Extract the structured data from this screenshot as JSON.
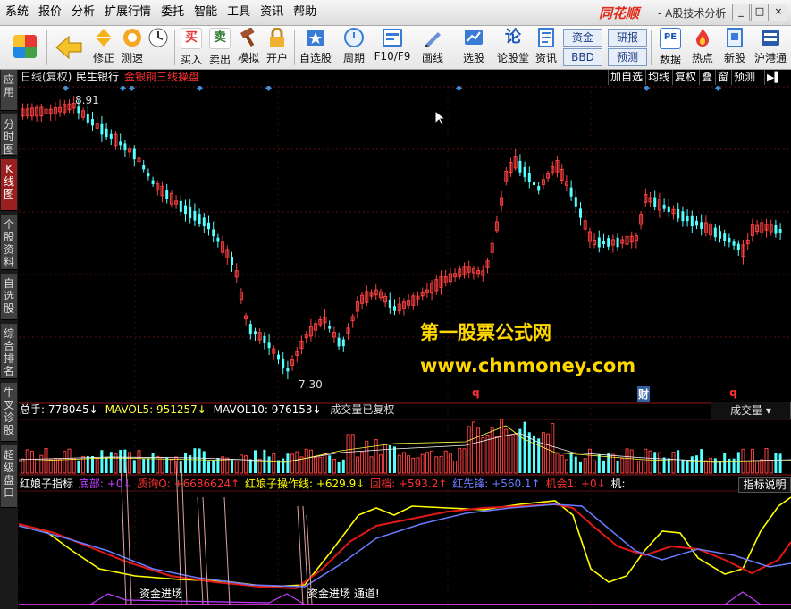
{
  "menubar": {
    "items": [
      "系统",
      "报价",
      "分析",
      "扩展行情",
      "委托",
      "智能",
      "工具",
      "资讯",
      "帮助"
    ],
    "logo": "同花顺",
    "app_subtitle": "- A股技术分析",
    "win_controls": [
      "_",
      "□",
      "×"
    ]
  },
  "toolbar": {
    "buttons": [
      {
        "label": "",
        "icon": "layout-icon"
      },
      {
        "label": "",
        "icon": "back-arrow-icon"
      },
      {
        "label": "修正",
        "icon": "up-down-icon"
      },
      {
        "label": "测速",
        "icon": "speed-icon"
      },
      {
        "label": "",
        "icon": "clock-icon"
      },
      {
        "label": "买入",
        "icon": "buy-icon",
        "glyph": "买"
      },
      {
        "label": "卖出",
        "icon": "sell-icon",
        "glyph": "卖"
      },
      {
        "label": "模拟",
        "icon": "hammer-icon"
      },
      {
        "label": "开户",
        "icon": "lock-icon"
      },
      {
        "label": "自选股",
        "icon": "star-icon"
      },
      {
        "label": "周期",
        "icon": "period-icon"
      },
      {
        "label": "F10/F9",
        "icon": "f10-icon"
      },
      {
        "label": "画线",
        "icon": "pen-icon"
      },
      {
        "label": "选股",
        "icon": "select-icon"
      },
      {
        "label": "论股堂",
        "icon": "forum-icon",
        "glyph": "论"
      },
      {
        "label": "资讯",
        "icon": "news-icon"
      },
      {
        "label": "数据",
        "icon": "pe-icon",
        "glyph": "PE"
      },
      {
        "label": "热点",
        "icon": "hot-icon"
      },
      {
        "label": "新股",
        "icon": "ipo-icon"
      },
      {
        "label": "沪港通",
        "icon": "hk-icon"
      }
    ],
    "pills": [
      "资金",
      "研报",
      "BBD",
      "预测"
    ]
  },
  "sidebar": {
    "tabs": [
      {
        "label": "应用",
        "active": false
      },
      {
        "label": "分时图",
        "active": false
      },
      {
        "label": "K线图",
        "active": true
      },
      {
        "label": "个股资料",
        "active": false
      },
      {
        "label": "自选股",
        "active": false
      },
      {
        "label": "综合排名",
        "active": false
      },
      {
        "label": "牛叉诊股",
        "active": false
      },
      {
        "label": "超级盘口",
        "active": false
      }
    ]
  },
  "kline": {
    "period": "日线(复权)",
    "stock": "民生银行",
    "formula": "金银铜三线操盘",
    "buttons": [
      "加自选",
      "均线",
      "复权",
      "叠",
      "窗",
      "预测"
    ],
    "high_label": "8.91",
    "low_label": "7.30",
    "markers": [
      "q",
      "财",
      "q"
    ]
  },
  "volume": {
    "total_label": "总手: 778045↓",
    "mavol5_label": "MAVOL5: 951257↓",
    "mavol10_label": "MAVOL10: 976153↓",
    "status": "成交量已复权",
    "dropdown": "成交量"
  },
  "indicator": {
    "name": "红娘子指标",
    "parts": [
      {
        "text": "底部: +0↓",
        "color": "#c040ff"
      },
      {
        "text": "质询Q: +6686624↑",
        "color": "#ff3030"
      },
      {
        "text": "红娘子操作线: +629.9↓",
        "color": "#ffff00"
      },
      {
        "text": "回档: +593.2↑",
        "color": "#ff3030"
      },
      {
        "text": "红先锋: +560.1↑",
        "color": "#6a7cff"
      },
      {
        "text": "机会1: +0↓",
        "color": "#ff3030"
      },
      {
        "text": "机:",
        "color": "#ffffff"
      }
    ],
    "help_button": "指标说明",
    "annotations": [
      "资金进场",
      "资金进场 通道!"
    ]
  },
  "watermark": {
    "line1": "第一股票公式网",
    "line2": "www.chnmoney.com"
  },
  "colors": {
    "up": "#ff4040",
    "down": "#54ffff",
    "accent": "#ffd700"
  }
}
